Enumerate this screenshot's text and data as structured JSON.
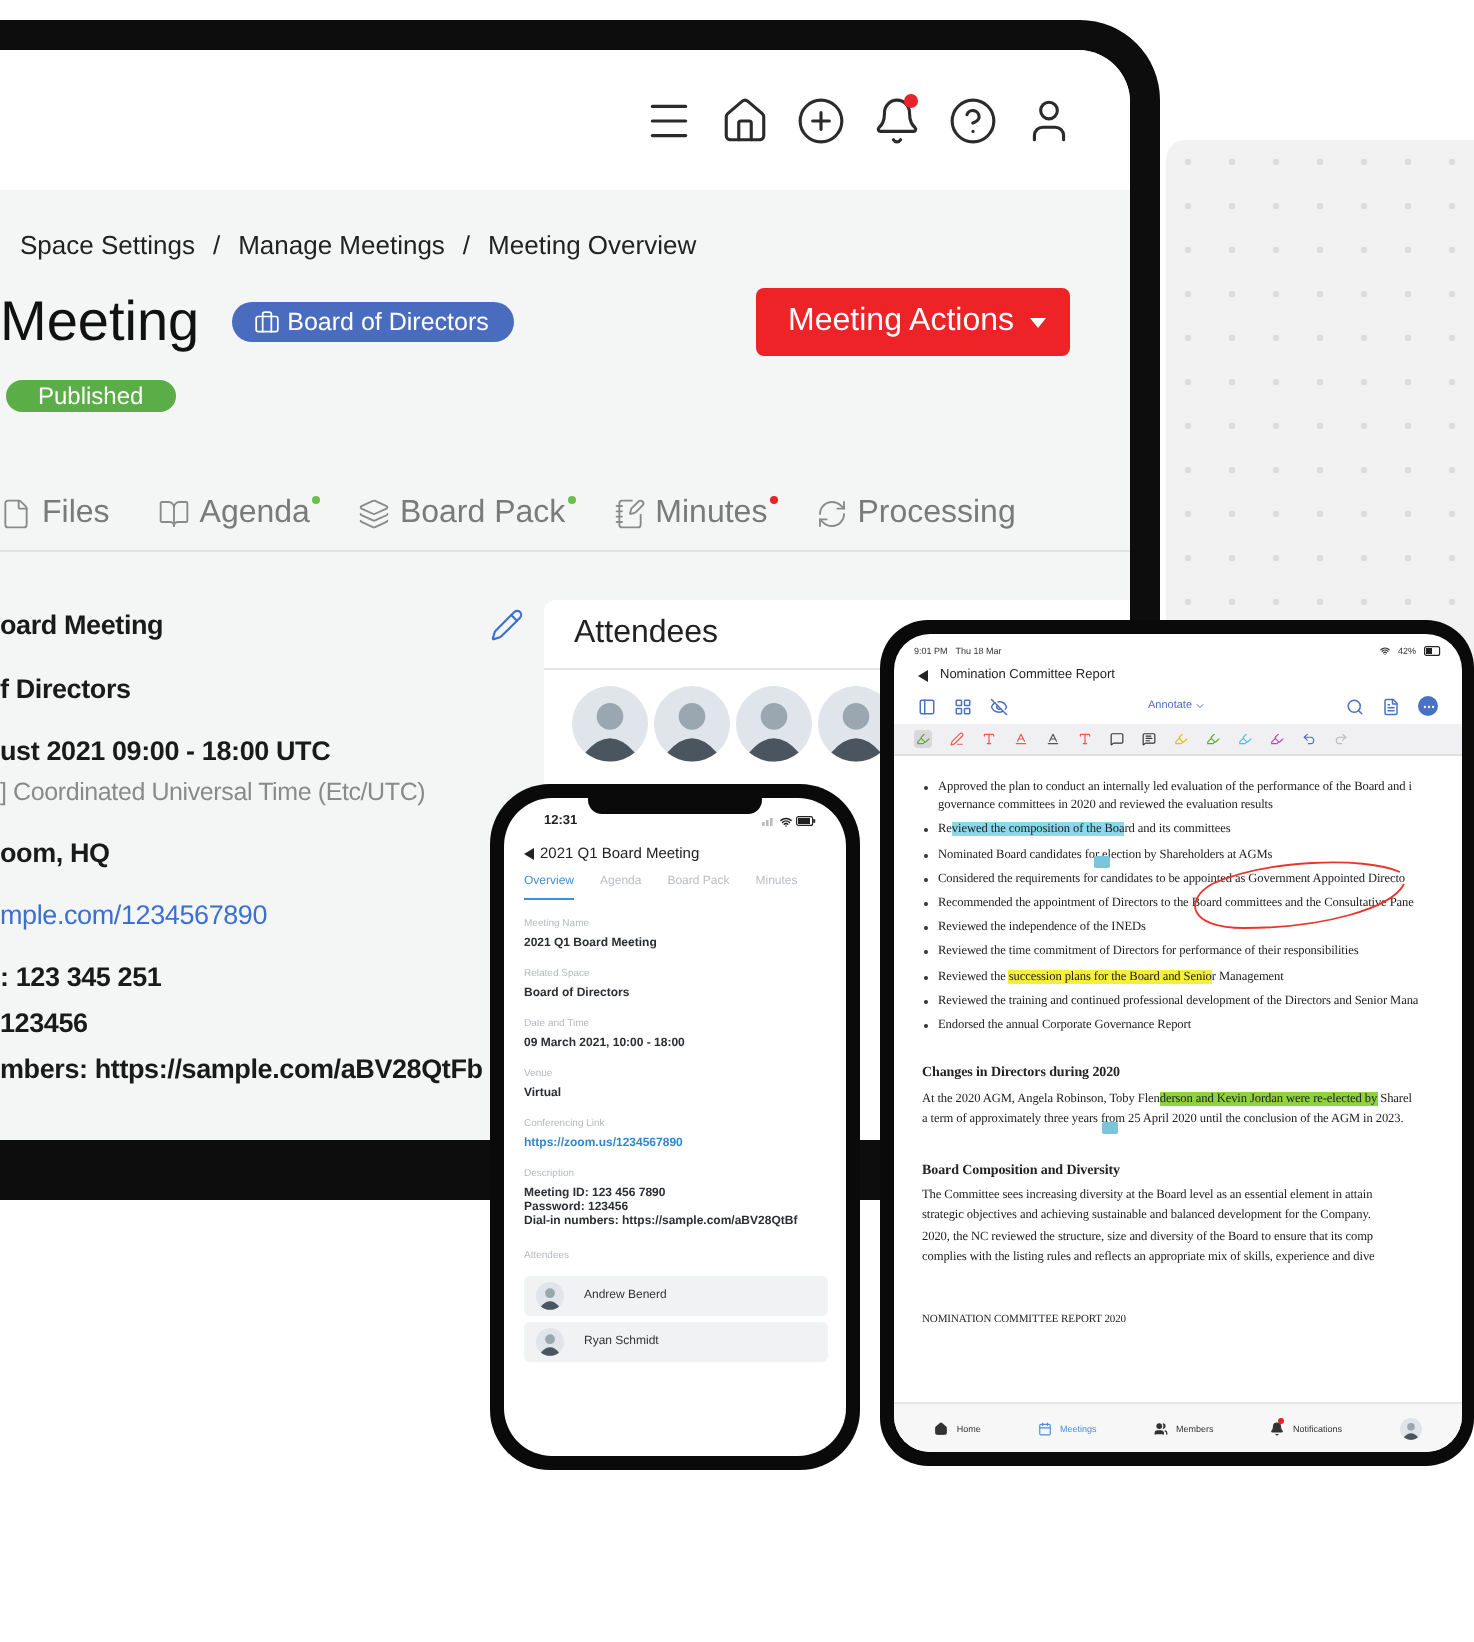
{
  "laptop": {
    "header": {
      "notification_dot": true
    },
    "breadcrumb": {
      "separator": "/",
      "items": [
        "Space Settings",
        "Manage Meetings",
        "Meeting Overview"
      ]
    },
    "title": "Meeting",
    "space_badge": "Board of Directors",
    "status": "Published",
    "actions_button": "Meeting Actions",
    "tabs": [
      {
        "label": "Files"
      },
      {
        "label": "Agenda",
        "color": "#6cc04a"
      },
      {
        "label": "Board Pack",
        "color": "#6cc04a"
      },
      {
        "label": "Minutes",
        "color": "#e8242a"
      },
      {
        "label": "Processing"
      }
    ],
    "details": [
      {
        "kind": "value",
        "text": "oard Meeting"
      },
      {
        "kind": "value",
        "text": "f Directors"
      },
      {
        "kind": "value",
        "text": "ust 2021 09:00 - 18:00 UTC"
      },
      {
        "kind": "note",
        "text": "] Coordinated Universal Time (Etc/UTC)"
      },
      {
        "kind": "value",
        "text": "oom, HQ"
      },
      {
        "kind": "link",
        "text": "mple.com/1234567890"
      },
      {
        "kind": "value",
        "text": ": 123 345 251"
      },
      {
        "kind": "desc",
        "text": "123456"
      },
      {
        "kind": "desc",
        "text": "mbers: https://sample.com/aBV28QtFb"
      }
    ],
    "attendees": {
      "title": "Attendees"
    }
  },
  "phone": {
    "time": "12:31",
    "title": "2021 Q1 Board Meeting",
    "tabs": [
      {
        "label": "Overview",
        "selected": true
      },
      {
        "label": "Agenda",
        "selected": false
      },
      {
        "label": "Board Pack",
        "selected": false
      },
      {
        "label": "Minutes",
        "selected": false
      }
    ],
    "fields": [
      {
        "label": "Meeting Name",
        "kind": "text",
        "value": "2021 Q1 Board Meeting"
      },
      {
        "label": "Related Space",
        "kind": "text",
        "value": "Board of Directors"
      },
      {
        "label": "Date and Time",
        "kind": "text",
        "value": "09 March 2021, 10:00 - 18:00"
      },
      {
        "label": "Venue",
        "kind": "text",
        "value": "Virtual"
      },
      {
        "label": "Conferencing Link",
        "kind": "link",
        "value": "https://zoom.us/1234567890"
      },
      {
        "label": "Description",
        "kind": "lines",
        "lines": [
          "Meeting ID: 123 456 7890",
          "Password: 123456",
          "Dial-in numbers: https://sample.com/aBV28QtBf"
        ]
      }
    ],
    "attendees_label": "Attendees",
    "attendees": [
      "Andrew Benerd",
      "Ryan Schmidt"
    ]
  },
  "tablet": {
    "time": "9:01 PM",
    "date": "Thu 18 Mar",
    "battery": "42%",
    "title": "Nomination Committee Report",
    "mode": "Annotate",
    "document": [
      {
        "kind": "bullet",
        "lines": [
          "Approved the plan to conduct an internally led evaluation of the performance of the Board and i",
          "governance committees in 2020 and reviewed the evaluation results"
        ]
      },
      {
        "kind": "bullet",
        "lines": [
          {
            "segments": [
              {
                "text": "Re"
              },
              {
                "text": "viewed the composition of the Boa",
                "color": "#8ad8ea"
              },
              {
                "text": "rd and its committees"
              }
            ]
          }
        ]
      },
      {
        "kind": "bullet",
        "lines": [
          "Nominated Board candidates for election by Shareholders at AGMs"
        ]
      },
      {
        "kind": "bullet",
        "lines": [
          "Considered the requirements for candidates to be appointed as Government Appointed Directo"
        ]
      },
      {
        "kind": "bullet",
        "lines": [
          "Recommended the appointment of Directors to the Board committees and the Consultative Pane"
        ]
      },
      {
        "kind": "bullet",
        "lines": [
          "Reviewed the independence of the INEDs"
        ]
      },
      {
        "kind": "bullet",
        "lines": [
          "Reviewed the time commitment of Directors for performance of their responsibilities"
        ]
      },
      {
        "kind": "bullet",
        "lines": [
          {
            "segments": [
              {
                "text": "Reviewed the "
              },
              {
                "text": "succession plans for the Board and Senio",
                "color": "#f5ee3a"
              },
              {
                "text": "r Management"
              }
            ]
          }
        ]
      },
      {
        "kind": "bullet",
        "lines": [
          "Reviewed the training and continued professional development of the Directors and Senior Mana"
        ]
      },
      {
        "kind": "bullet",
        "lines": [
          "Endorsed the annual Corporate Governance Report"
        ]
      },
      {
        "kind": "heading",
        "lines": [
          "Changes in Directors during 2020"
        ]
      },
      {
        "kind": "paragraph",
        "lines": [
          {
            "segments": [
              {
                "text": "At the 2020 AGM, Angela Robinson, Toby Flen"
              },
              {
                "text": "derson and Kevin Jordan were re-elected by",
                "color": "#8ed23c"
              },
              {
                "text": " Sharel"
              }
            ]
          },
          "a term of approximately three years from 25 April 2020 until the conclusion of the AGM in 2023."
        ]
      },
      {
        "kind": "heading",
        "lines": [
          "Board Composition and Diversity"
        ]
      },
      {
        "kind": "paragraph",
        "lines": [
          "The Committee sees increasing diversity at the Board level as an essential element in attain",
          "strategic objectives and achieving sustainable and balanced development for the Company.",
          "2020, the NC reviewed the structure, size and diversity of the Board to ensure that its comp",
          "complies with the listing rules and reflects an appropriate mix of skills, experience and dive"
        ]
      },
      {
        "kind": "footer",
        "lines": [
          "NOMINATION COMMITTEE REPORT 2020"
        ]
      }
    ],
    "nav": [
      {
        "label": "Home",
        "selected": false,
        "badge": false
      },
      {
        "label": "Meetings",
        "selected": true,
        "badge": false
      },
      {
        "label": "Members",
        "selected": false,
        "badge": false
      },
      {
        "label": "Notifications",
        "selected": false,
        "badge": true
      }
    ]
  }
}
